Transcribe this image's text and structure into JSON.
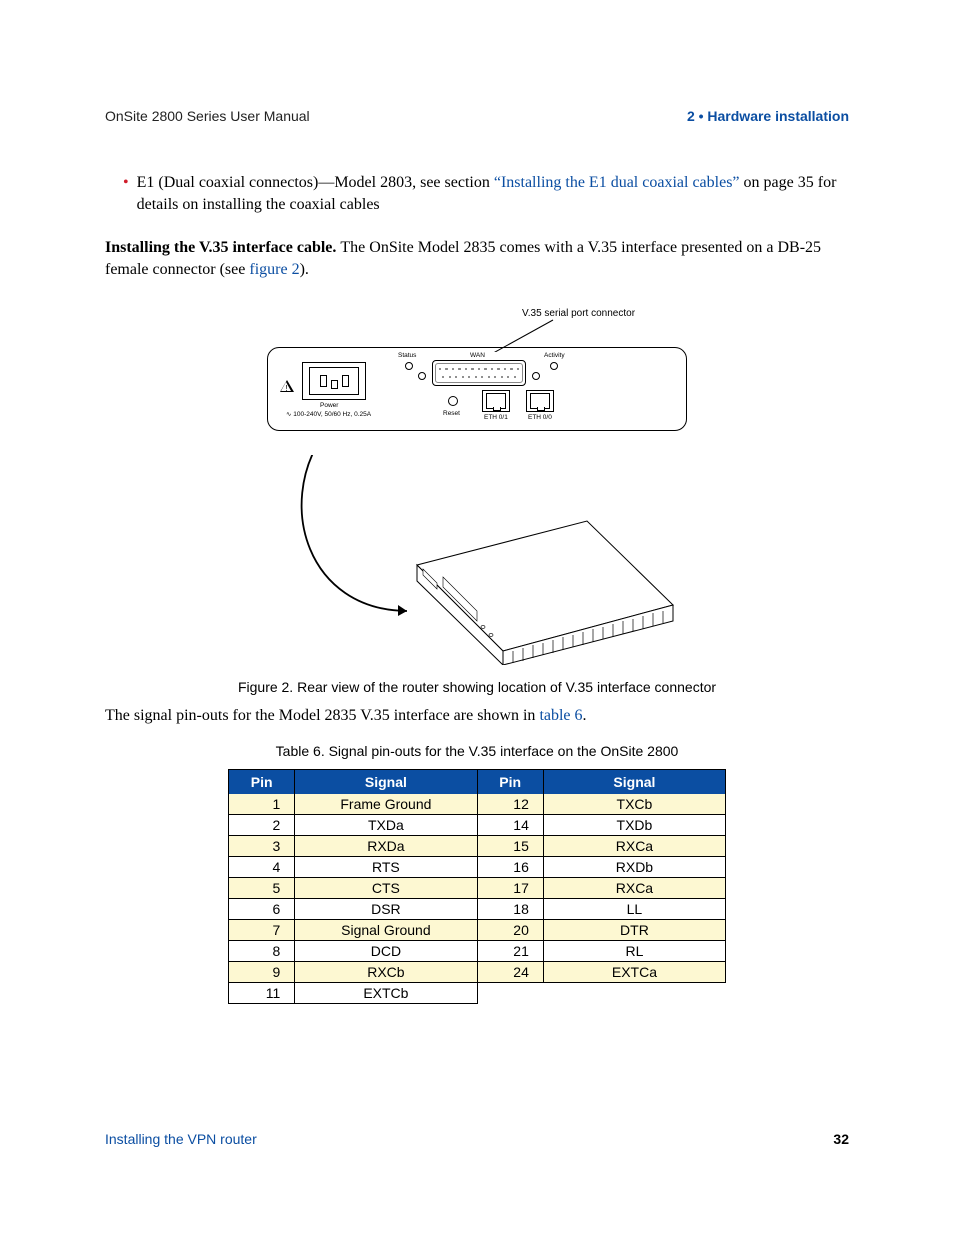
{
  "header": {
    "left": "OnSite 2800 Series User Manual",
    "right": "2 • Hardware installation"
  },
  "bullet": {
    "prefix": "E1 (Dual coaxial connectos)—Model 2803, see section ",
    "link": "“Installing the E1 dual coaxial cables”",
    "mid": " on page 35 for details on installing the coaxial cables"
  },
  "para_install": {
    "bold": "Installing the V.35 interface cable. ",
    "rest1": "The OnSite Model 2835 comes with a V.35 interface presented on a DB-25 female connector (see ",
    "link": "figure 2",
    "rest2": ")."
  },
  "figure": {
    "callout": "V.35 serial port connector",
    "labels": {
      "status": "Status",
      "wan": "WAN",
      "activity": "Activity",
      "reset": "Reset",
      "eth01": "ETH 0/1",
      "eth00": "ETH 0/0",
      "power": "Power",
      "power_spec": "100-240V, 50/60 Hz, 0.25A",
      "sine": "∿"
    },
    "caption": "Figure 2. Rear view of the router showing location of V.35 interface connector"
  },
  "para_pinouts": {
    "text1": "The signal pin-outs for the Model 2835 V.35 interface are shown in ",
    "link": "table 6",
    "text2": "."
  },
  "table": {
    "caption": "Table 6. Signal pin-outs for the V.35 interface on the OnSite 2800",
    "head_pin": "Pin",
    "head_signal": "Signal",
    "rows": [
      {
        "p1": "1",
        "s1": "Frame Ground",
        "p2": "12",
        "s2": "TXCb"
      },
      {
        "p1": "2",
        "s1": "TXDa",
        "p2": "14",
        "s2": "TXDb"
      },
      {
        "p1": "3",
        "s1": "RXDa",
        "p2": "15",
        "s2": "RXCa"
      },
      {
        "p1": "4",
        "s1": "RTS",
        "p2": "16",
        "s2": "RXDb"
      },
      {
        "p1": "5",
        "s1": "CTS",
        "p2": "17",
        "s2": "RXCa"
      },
      {
        "p1": "6",
        "s1": "DSR",
        "p2": "18",
        "s2": "LL"
      },
      {
        "p1": "7",
        "s1": "Signal Ground",
        "p2": "20",
        "s2": "DTR"
      },
      {
        "p1": "8",
        "s1": "DCD",
        "p2": "21",
        "s2": "RL"
      },
      {
        "p1": "9",
        "s1": "RXCb",
        "p2": "24",
        "s2": "EXTCa"
      },
      {
        "p1": "11",
        "s1": "EXTCb",
        "p2": "",
        "s2": ""
      }
    ]
  },
  "footer": {
    "left": "Installing the VPN router",
    "page": "32"
  }
}
